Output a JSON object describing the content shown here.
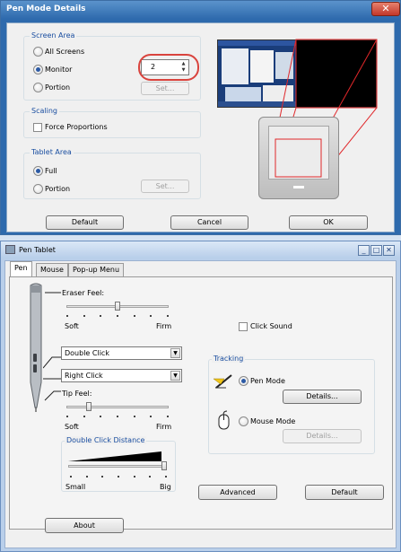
{
  "pen_mode_details": {
    "title": "Pen Mode Details",
    "screen_area": {
      "legend": "Screen Area",
      "options": [
        "All Screens",
        "Monitor",
        "Portion"
      ],
      "selected": "Monitor",
      "monitor_number": "2",
      "set_label": "Set..."
    },
    "scaling": {
      "legend": "Scaling",
      "force_proportions_label": "Force Proportions",
      "force_proportions_checked": false
    },
    "tablet_area": {
      "legend": "Tablet Area",
      "options": [
        "Full",
        "Portion"
      ],
      "selected": "Full",
      "set_label": "Set..."
    },
    "buttons": {
      "default": "Default",
      "cancel": "Cancel",
      "ok": "OK"
    },
    "close_glyph": "✕",
    "highlight_color": "#d9433d"
  },
  "pen_tablet": {
    "title": "Pen Tablet",
    "caption_buttons": {
      "minimize": "_",
      "maximize": "□",
      "close": "✕"
    },
    "tabs": [
      "Pen",
      "Mouse",
      "Pop-up Menu"
    ],
    "selected_tab": "Pen",
    "eraser_feel": {
      "label": "Eraser Feel:",
      "min_label": "Soft",
      "max_label": "Firm",
      "level": 0.5
    },
    "side_switch_upper": "Double Click",
    "side_switch_lower": "Right Click",
    "tip_feel": {
      "label": "Tip Feel:",
      "min_label": "Soft",
      "max_label": "Firm",
      "level": 0.2
    },
    "double_click_distance": {
      "legend": "Double Click Distance",
      "min_label": "Small",
      "max_label": "Big",
      "level": 1.0
    },
    "click_sound": {
      "label": "Click Sound",
      "checked": false
    },
    "tracking": {
      "legend": "Tracking",
      "pen_mode_label": "Pen Mode",
      "mouse_mode_label": "Mouse Mode",
      "selected": "Pen Mode",
      "details_label": "Details...",
      "details_disabled_label": "Details..."
    },
    "buttons": {
      "advanced": "Advanced",
      "default": "Default",
      "about": "About"
    }
  }
}
